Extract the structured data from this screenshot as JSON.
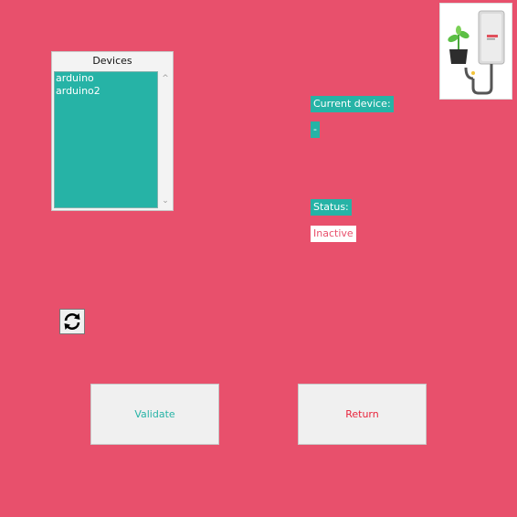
{
  "devices": {
    "title": "Devices",
    "items": [
      "arduino",
      "arduino2"
    ]
  },
  "current_device": {
    "label": "Current device:",
    "value": "-"
  },
  "status": {
    "label": "Status:",
    "value": "Inactive"
  },
  "buttons": {
    "validate": "Validate",
    "return": "Return"
  },
  "icons": {
    "refresh": "refresh-icon",
    "logo": "plant-watering-device-logo"
  },
  "colors": {
    "background": "#e8506c",
    "accent": "#26b3a6",
    "inactive": "#e8506c"
  }
}
